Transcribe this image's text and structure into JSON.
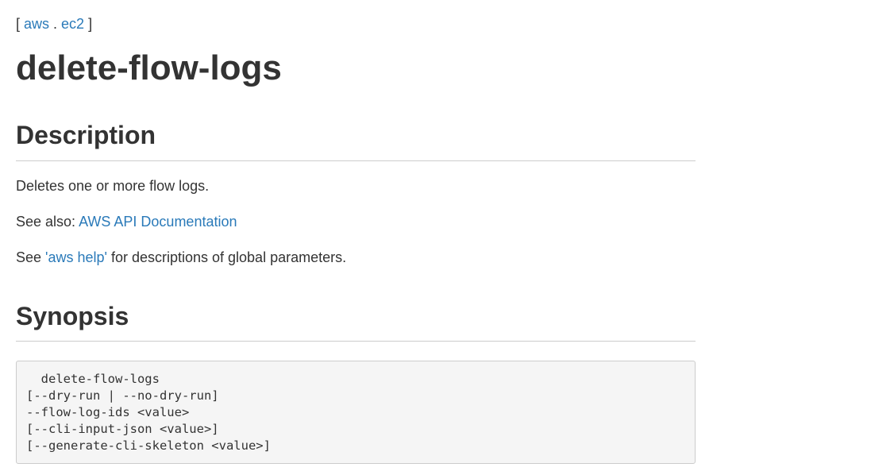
{
  "breadcrumb": {
    "open": "[ ",
    "items": [
      {
        "label": "aws"
      },
      {
        "label": "ec2"
      }
    ],
    "separator": " . ",
    "close": " ]"
  },
  "page_title": "delete-flow-logs",
  "description": {
    "heading": "Description",
    "summary": "Deletes one or more flow logs.",
    "see_also_prefix": "See also: ",
    "see_also_link": "AWS API Documentation",
    "help_prefix": "See ",
    "help_link": "'aws help'",
    "help_suffix": " for descriptions of global parameters."
  },
  "synopsis": {
    "heading": "Synopsis",
    "lines": [
      "  delete-flow-logs",
      "[--dry-run | --no-dry-run]",
      "--flow-log-ids <value>",
      "[--cli-input-json <value>]",
      "[--generate-cli-skeleton <value>]"
    ]
  },
  "colors": {
    "text": "#333333",
    "link": "#2a7ab9",
    "rule": "#cccccc",
    "code_background": "#f5f5f5"
  }
}
